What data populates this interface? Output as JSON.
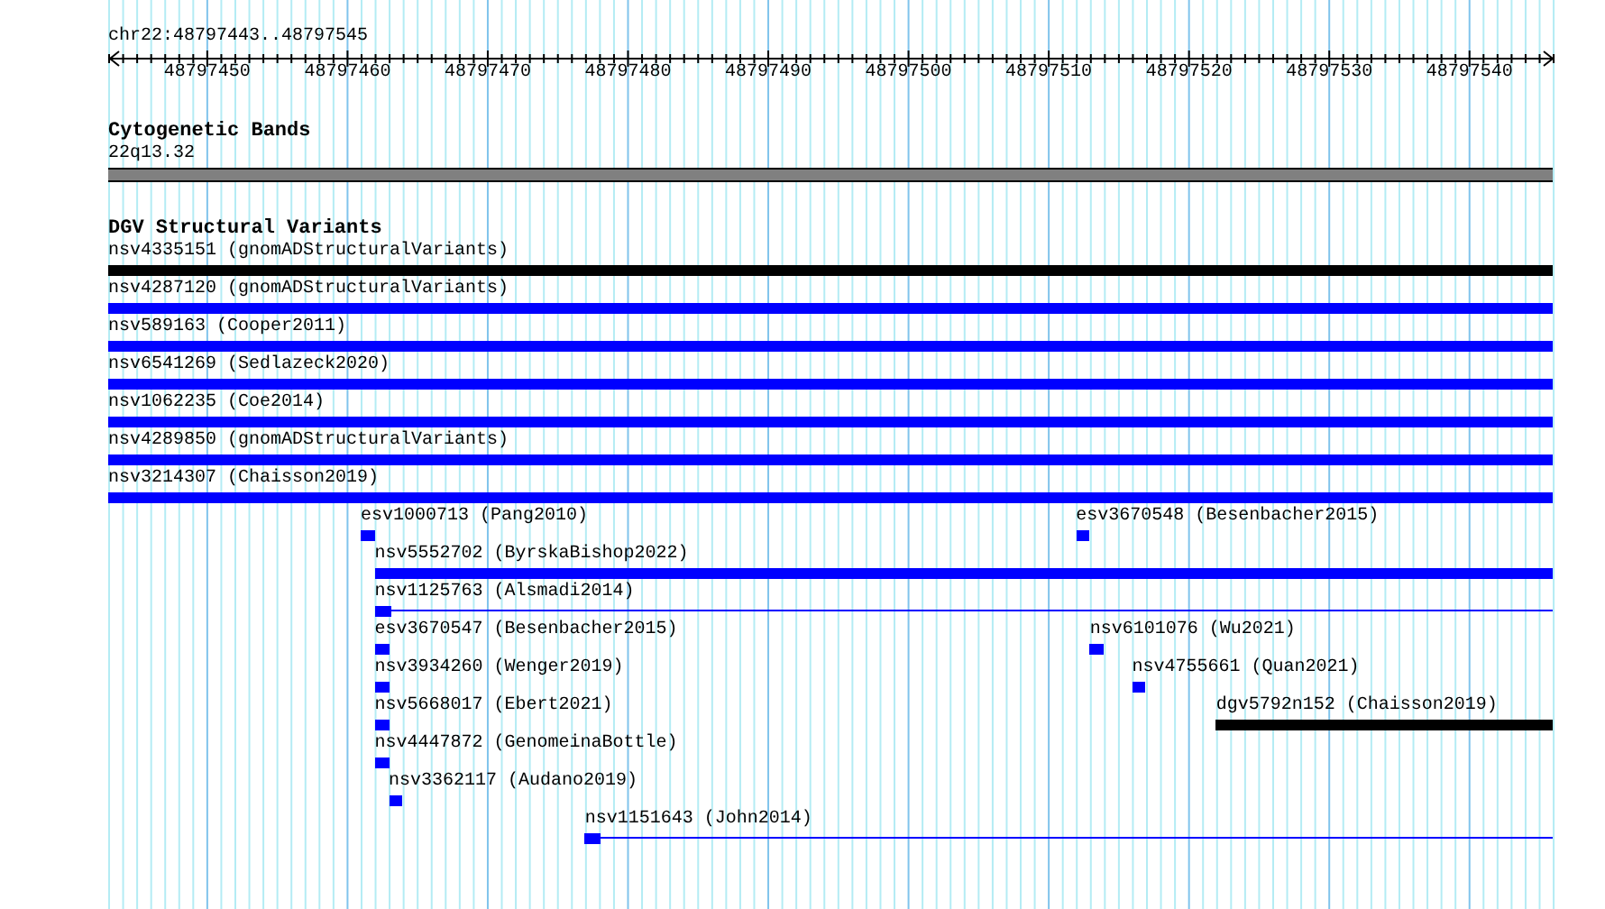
{
  "ruler": {
    "location": "chr22:48797443..48797545",
    "ticks": [
      "48797450",
      "48797460",
      "48797470",
      "48797480",
      "48797490",
      "48797500",
      "48797510",
      "48797520",
      "48797530",
      "48797540"
    ]
  },
  "cytogenetic_bands": {
    "title": "Cytogenetic Bands",
    "band": "22q13.32"
  },
  "dgv_structural_variants": {
    "title": "DGV Structural Variants",
    "features": [
      {
        "label": "nsv4335151 (gnomADStructuralVariants)",
        "kind": "bar",
        "color": "#000000"
      },
      {
        "label": "nsv4287120 (gnomADStructuralVariants)",
        "kind": "bar",
        "color": "#0000ff"
      },
      {
        "label": "nsv589163 (Cooper2011)",
        "kind": "bar",
        "color": "#0000ff"
      },
      {
        "label": "nsv6541269 (Sedlazeck2020)",
        "kind": "bar",
        "color": "#0000ff"
      },
      {
        "label": "nsv1062235 (Coe2014)",
        "kind": "bar",
        "color": "#0000ff"
      },
      {
        "label": "nsv4289850 (gnomADStructuralVariants)",
        "kind": "bar",
        "color": "#0000ff"
      },
      {
        "label": "nsv3214307 (Chaisson2019)",
        "kind": "bar",
        "color": "#0000ff"
      },
      {
        "label": "esv1000713 (Pang2010)",
        "kind": "bar",
        "color": "#0000ff"
      },
      {
        "label": "esv3670548 (Besenbacher2015)",
        "kind": "bar",
        "color": "#0000ff"
      },
      {
        "label": "nsv5552702 (ByrskaBishop2022)",
        "kind": "bar",
        "color": "#0000ff"
      },
      {
        "label": "nsv1125763 (Alsmadi2014)",
        "kind": "block_line",
        "color": "#0000ff"
      },
      {
        "label": "esv3670547 (Besenbacher2015)",
        "kind": "bar",
        "color": "#0000ff"
      },
      {
        "label": "nsv6101076 (Wu2021)",
        "kind": "bar",
        "color": "#0000ff"
      },
      {
        "label": "nsv3934260 (Wenger2019)",
        "kind": "bar",
        "color": "#0000ff"
      },
      {
        "label": "nsv4755661 (Quan2021)",
        "kind": "bar",
        "color": "#0000ff"
      },
      {
        "label": "nsv5668017 (Ebert2021)",
        "kind": "bar",
        "color": "#0000ff"
      },
      {
        "label": "dgv5792n152 (Chaisson2019)",
        "kind": "bar",
        "color": "#000000"
      },
      {
        "label": "nsv4447872 (GenomeinaBottle)",
        "kind": "bar",
        "color": "#0000ff"
      },
      {
        "label": "nsv3362117 (Audano2019)",
        "kind": "bar",
        "color": "#0000ff"
      },
      {
        "label": "nsv1151643 (John2014)",
        "kind": "block_line",
        "color": "#0000ff"
      }
    ]
  }
}
